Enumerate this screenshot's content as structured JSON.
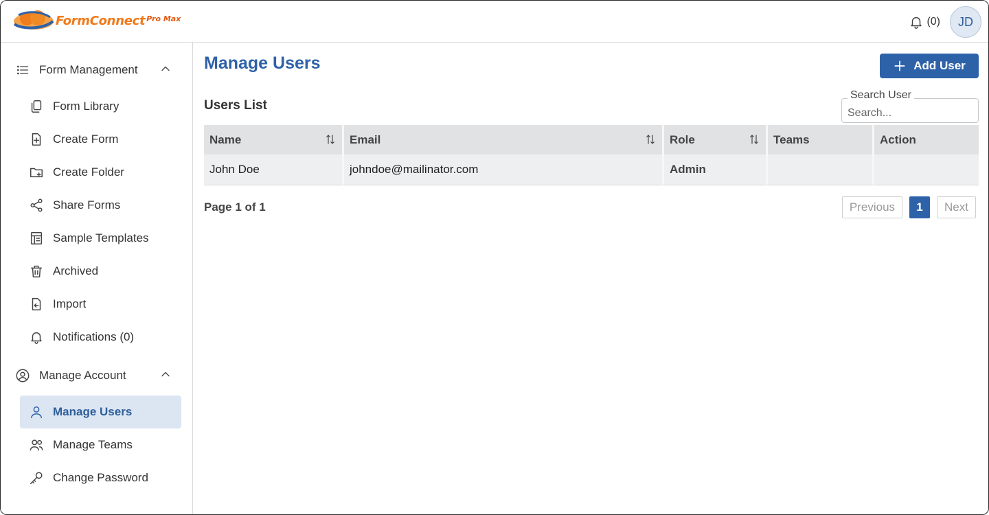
{
  "app": {
    "logo_text": "FormConnect",
    "logo_sub": "Pro Max"
  },
  "header": {
    "notifications_label": "(0)",
    "avatar_initials": "JD"
  },
  "sidebar": {
    "form_management": {
      "label": "Form Management",
      "items": [
        {
          "label": "Form Library",
          "icon": "copy-icon"
        },
        {
          "label": "Create Form",
          "icon": "file-plus-icon"
        },
        {
          "label": "Create Folder",
          "icon": "folder-plus-icon"
        },
        {
          "label": "Share Forms",
          "icon": "share-icon"
        },
        {
          "label": "Sample Templates",
          "icon": "template-icon"
        },
        {
          "label": "Archived",
          "icon": "trash-icon"
        },
        {
          "label": "Import",
          "icon": "file-import-icon"
        },
        {
          "label": "Notifications (0)",
          "icon": "bell-icon"
        }
      ]
    },
    "manage_account": {
      "label": "Manage Account",
      "items": [
        {
          "label": "Manage Users",
          "icon": "user-icon",
          "active": true
        },
        {
          "label": "Manage Teams",
          "icon": "users-icon"
        },
        {
          "label": "Change Password",
          "icon": "key-icon"
        }
      ]
    }
  },
  "main": {
    "title": "Manage Users",
    "add_button": "Add User",
    "list_title": "Users List",
    "search": {
      "label": "Search User",
      "placeholder": "Search..."
    },
    "table": {
      "columns": [
        "Name",
        "Email",
        "Role",
        "Teams",
        "Action"
      ],
      "rows": [
        {
          "name": "John Doe",
          "email": "johndoe@mailinator.com",
          "role": "Admin",
          "teams": "",
          "action": ""
        }
      ]
    },
    "pagination": {
      "info": "Page 1 of 1",
      "previous": "Previous",
      "current": "1",
      "next": "Next"
    }
  },
  "colors": {
    "primary": "#2e62a8",
    "active_bg": "#dce6f3",
    "logo_orange": "#f07a1a"
  }
}
